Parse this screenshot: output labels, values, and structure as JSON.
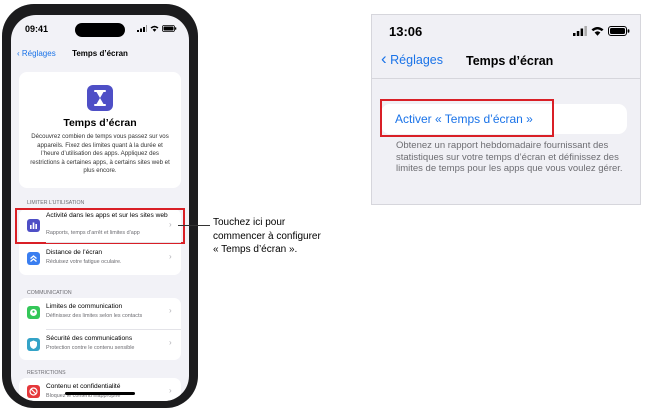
{
  "phone": {
    "status_time": "09:41",
    "nav_back": "Réglages",
    "nav_title": "Temps d’écran",
    "hero_title": "Temps d’écran",
    "hero_text": "Découvrez combien de temps vous passez sur vos appareils. Fixez des limites quant à la durée et l’heure d’utilisation des apps. Appliquez des restrictions à certaines apps, à certains sites web et plus encore.",
    "sections": [
      {
        "label": "LIMITER L’UTILISATION",
        "rows": [
          {
            "title": "Activité dans les apps et sur les sites web",
            "sub": "Rapports, temps d’arrêt et limites d’app",
            "icon": "chart-bars-icon",
            "color": "#4e4fc6"
          },
          {
            "title": "Distance de l’écran",
            "sub": "Réduisez votre fatigue oculaire.",
            "icon": "chevrons-up-icon",
            "color": "#3a7ef0"
          }
        ]
      },
      {
        "label": "COMMUNICATION",
        "rows": [
          {
            "title": "Limites de communication",
            "sub": "Définissez des limites selon les contacts",
            "icon": "chat-person-icon",
            "color": "#34c759"
          },
          {
            "title": "Sécurité des communications",
            "sub": "Protection contre le contenu sensible",
            "icon": "shield-chat-icon",
            "color": "#34a3c7"
          }
        ]
      },
      {
        "label": "RESTRICTIONS",
        "rows": [
          {
            "title": "Contenu et confidentialité",
            "sub": "Bloquez le contenu inapproprié",
            "icon": "restricted-icon",
            "color": "#e5383b"
          }
        ]
      }
    ]
  },
  "callout": "Touchez ici pour commencer à configurer « Temps d’écran ».",
  "panel": {
    "status_time": "13:06",
    "nav_back": "Réglages",
    "nav_title": "Temps d’écran",
    "activate_label": "Activer « Temps d’écran »",
    "footer": "Obtenez un rapport hebdomadaire fournissant des statistiques sur votre temps d’écran et définissez des limites de temps pour les apps que vous voulez gérer."
  }
}
